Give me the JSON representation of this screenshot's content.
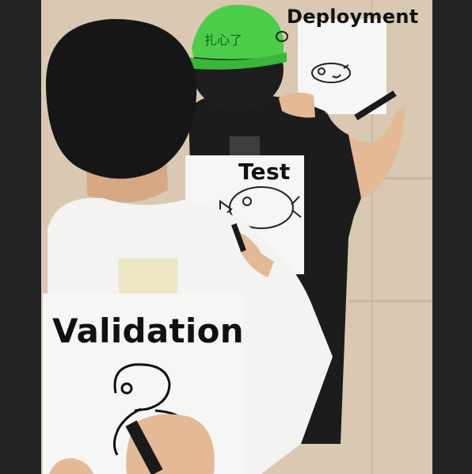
{
  "labels": {
    "deployment": "Deployment",
    "test": "Test",
    "validation": "Validation"
  },
  "hat_text": "扎心了",
  "colors": {
    "wall": "#d9c9b2",
    "side_bars": "#232323",
    "hat": "#4ccd4a",
    "black_shirt": "#1c1c1c",
    "white_shirt": "#f3f3f1",
    "skin": "#e4b996",
    "marker": "#1a1a1a"
  }
}
